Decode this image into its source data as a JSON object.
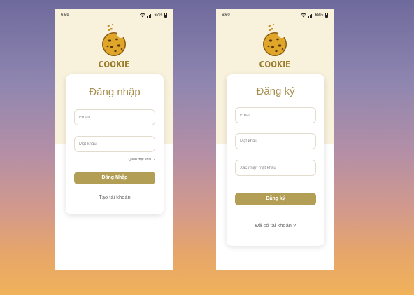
{
  "login_screen": {
    "status": {
      "time": "6:59",
      "battery": "67%"
    },
    "brand": "COOKIE",
    "title": "Đăng nhập",
    "email_placeholder": "Email",
    "password_placeholder": "Mật khẩu",
    "forgot_password": "Quên mật khẩu ?",
    "submit_label": "Đăng Nhập",
    "create_account": "Tạo tài khoản"
  },
  "register_screen": {
    "status": {
      "time": "6:60",
      "battery": "68%"
    },
    "brand": "COOKIE",
    "title": "Đăng ký",
    "email_placeholder": "Email",
    "password_placeholder": "Mật khẩu",
    "confirm_password_placeholder": "Xác nhận mật khẩu",
    "submit_label": "Đăng ký",
    "have_account": "Đã có tài khoản ?"
  },
  "colors": {
    "accent": "#b29f55",
    "title": "#a88e4e",
    "brand": "#9c7d2c",
    "header_bg": "#f8f2dc"
  }
}
